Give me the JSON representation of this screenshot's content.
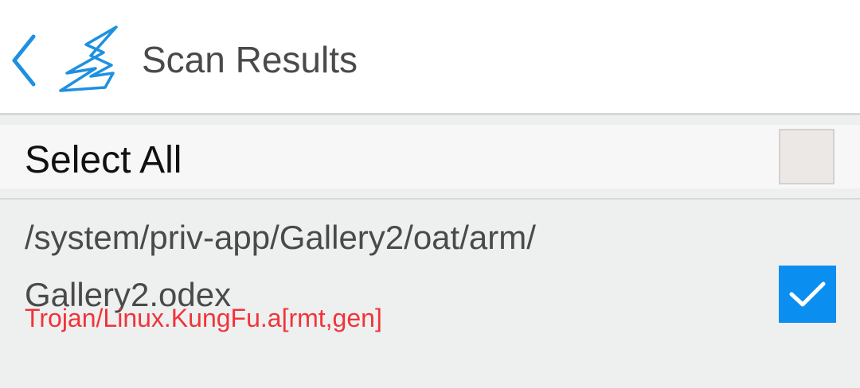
{
  "header": {
    "title": "Scan Results",
    "back_icon": "chevron-left-icon",
    "logo_icon": "app-logo-icon",
    "accent_color": "#1e90e0"
  },
  "select_all": {
    "label": "Select All",
    "checked": false
  },
  "results": [
    {
      "path_line1": "/system/priv-app/Gallery2/oat/arm/",
      "path_line2": "Gallery2.odex",
      "threat": "Trojan/Linux.KungFu.a[rmt,gen]",
      "checked": true,
      "threat_color": "#f0343a",
      "checkbox_color": "#0a8ff0"
    }
  ]
}
